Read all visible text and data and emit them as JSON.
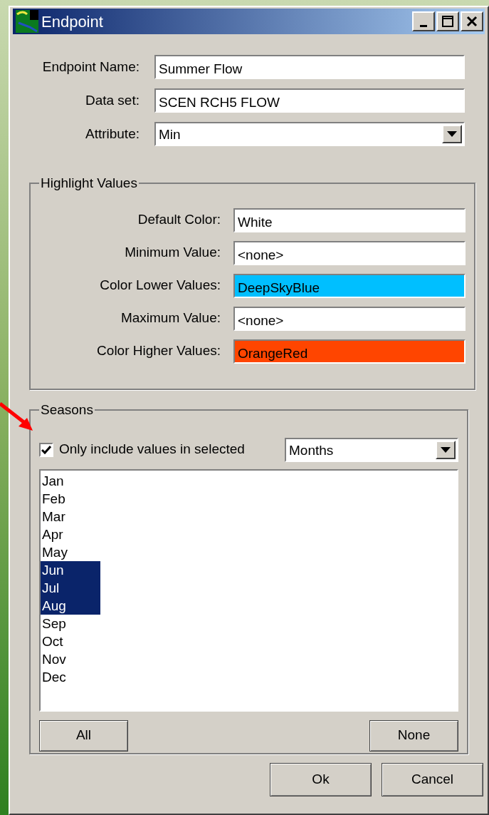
{
  "window": {
    "title": "Endpoint"
  },
  "fields": [
    {
      "kind": "text",
      "label": "Endpoint Name:",
      "value": "Summer Flow"
    },
    {
      "kind": "text",
      "label": "Data set:",
      "value": "SCEN RCH5 FLOW"
    },
    {
      "kind": "dropdown",
      "label": "Attribute:",
      "value": "Min"
    }
  ],
  "highlight": {
    "title": "Highlight Values",
    "fields": [
      {
        "label": "Default Color:",
        "value": "White",
        "color": "#ffffff"
      },
      {
        "label": "Minimum Value:",
        "value": "<none>"
      },
      {
        "label": "Color Lower Values:",
        "value": "DeepSkyBlue",
        "color": "#00bfff"
      },
      {
        "label": "Maximum Value:",
        "value": "<none>"
      },
      {
        "label": "Color Higher Values:",
        "value": "OrangeRed",
        "color": "#ff4500"
      }
    ]
  },
  "seasons": {
    "title": "Seasons",
    "filter": {
      "label": "Only include values in selected",
      "checked": true
    },
    "period": "Months",
    "months": [
      {
        "label": "Jan",
        "selected": false
      },
      {
        "label": "Feb",
        "selected": false
      },
      {
        "label": "Mar",
        "selected": false
      },
      {
        "label": "Apr",
        "selected": false
      },
      {
        "label": "May",
        "selected": false
      },
      {
        "label": "Jun",
        "selected": true
      },
      {
        "label": "Jul",
        "selected": true
      },
      {
        "label": "Aug",
        "selected": true
      },
      {
        "label": "Sep",
        "selected": false
      },
      {
        "label": "Oct",
        "selected": false
      },
      {
        "label": "Nov",
        "selected": false
      },
      {
        "label": "Dec",
        "selected": false
      }
    ],
    "buttons": [
      "All",
      "None"
    ]
  },
  "buttons": [
    "Ok",
    "Cancel"
  ]
}
